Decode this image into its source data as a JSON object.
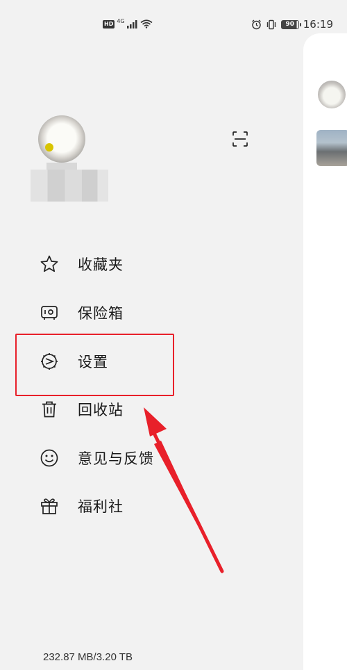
{
  "status_bar": {
    "hd": "HD",
    "network": "4G",
    "battery": "90",
    "time": "16:19"
  },
  "menu": {
    "items": [
      {
        "label": "收藏夹",
        "icon": "star-icon"
      },
      {
        "label": "保险箱",
        "icon": "safe-icon"
      },
      {
        "label": "设置",
        "icon": "settings-icon"
      },
      {
        "label": "回收站",
        "icon": "trash-icon"
      },
      {
        "label": "意见与反馈",
        "icon": "smiley-icon"
      },
      {
        "label": "福利社",
        "icon": "gift-icon"
      }
    ]
  },
  "storage": {
    "text": "232.87 MB/3.20 TB"
  },
  "annotation": {
    "highlight_color": "#e8202a"
  }
}
